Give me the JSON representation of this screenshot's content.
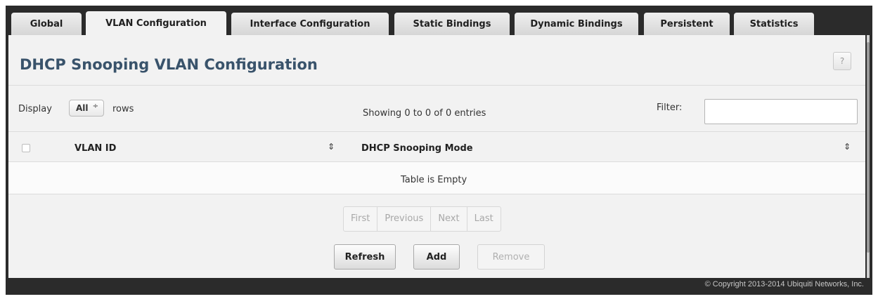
{
  "tabs": [
    {
      "label": "Global"
    },
    {
      "label": "VLAN Configuration"
    },
    {
      "label": "Interface Configuration"
    },
    {
      "label": "Static Bindings"
    },
    {
      "label": "Dynamic Bindings"
    },
    {
      "label": "Persistent"
    },
    {
      "label": "Statistics"
    }
  ],
  "active_tab": "VLAN Configuration",
  "page": {
    "title": "DHCP Snooping VLAN Configuration",
    "help_label": "?"
  },
  "toolbar": {
    "display_label": "Display",
    "rows_select_value": "All",
    "rows_label": "rows",
    "showing_text": "Showing 0 to 0 of 0 entries",
    "filter_label": "Filter:",
    "filter_value": ""
  },
  "table": {
    "columns": [
      {
        "label": "VLAN ID",
        "sort_icon": "sort-icon"
      },
      {
        "label": "DHCP Snooping Mode",
        "sort_icon": "sort-icon"
      }
    ],
    "empty_text": "Table is Empty"
  },
  "pagination": {
    "first": "First",
    "previous": "Previous",
    "next": "Next",
    "last": "Last"
  },
  "buttons": {
    "refresh": "Refresh",
    "add": "Add",
    "remove": "Remove"
  },
  "footer": {
    "copyright": "© Copyright 2013-2014 Ubiquiti Networks, Inc."
  },
  "colors": {
    "frame": "#2b2b2b",
    "panel": "#f2f2f2",
    "title": "#39536b"
  }
}
